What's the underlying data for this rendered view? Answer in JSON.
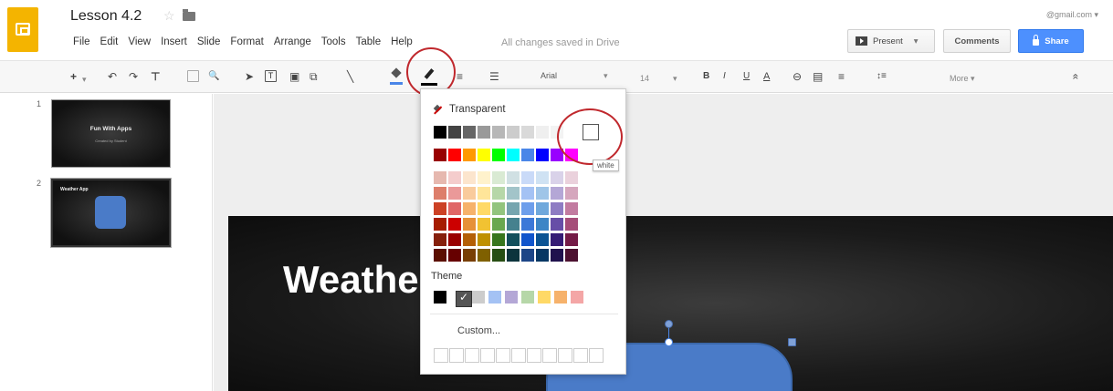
{
  "header": {
    "doc_title": "Lesson 4.2",
    "star_glyph": "☆",
    "account": "@gmail.com ▾",
    "save_status": "All changes saved in Drive",
    "menu": [
      "File",
      "Edit",
      "View",
      "Insert",
      "Slide",
      "Format",
      "Arrange",
      "Tools",
      "Table",
      "Help"
    ],
    "present_label": "Present",
    "present_caret": "▾",
    "comments_label": "Comments",
    "share_label": "Share"
  },
  "toolbar": {
    "add_glyph": "+",
    "add_caret": "▾",
    "undo_glyph": "↶",
    "redo_glyph": "↷",
    "paint_format_glyph": "⊤",
    "zoom_glyph": "🔍",
    "select_glyph": "➤",
    "textbox_glyph": "T",
    "image_glyph": "▣",
    "shape_glyph": "⧉",
    "line_glyph": "╲",
    "dash_glyph": "≡",
    "weight_glyph": "☰",
    "font": "Arial",
    "font_caret": "▾",
    "font_size": "14",
    "size_caret": "▾",
    "bold": "B",
    "italic": "I",
    "underline": "U",
    "text_color": "A",
    "link_glyph": "⊖",
    "comment_glyph": "▤",
    "align_glyph": "≡",
    "spacing_glyph": "↕≡",
    "more_label": "More ▾",
    "collapse_glyph": "«"
  },
  "filmstrip": {
    "slides": [
      {
        "number": "1",
        "title": "Fun With Apps",
        "subtitle": "Created by Student"
      },
      {
        "number": "2",
        "title": "Weather App"
      }
    ]
  },
  "canvas": {
    "slide_title": "Weathe",
    "shape_color": "#4a7bc8"
  },
  "color_menu": {
    "transparent_label": "Transparent",
    "tooltip": "white",
    "theme_label": "Theme",
    "theme_check": "✓",
    "custom_label": "Custom...",
    "grays": [
      "#000000",
      "#434343",
      "#666666",
      "#999999",
      "#b7b7b7",
      "#cccccc",
      "#d9d9d9",
      "#efefef",
      "#f3f3f3",
      "#ffffff"
    ],
    "brights": [
      "#980000",
      "#ff0000",
      "#ff9900",
      "#ffff00",
      "#00ff00",
      "#00ffff",
      "#4a86e8",
      "#0000ff",
      "#9900ff",
      "#ff00ff"
    ],
    "tints": [
      [
        "#e6b8af",
        "#f4cccc",
        "#fce5cd",
        "#fff2cc",
        "#d9ead3",
        "#d0e0e3",
        "#c9daf8",
        "#cfe2f3",
        "#d9d2e9",
        "#ead1dc"
      ],
      [
        "#dd7e6b",
        "#ea9999",
        "#f9cb9c",
        "#ffe599",
        "#b6d7a8",
        "#a2c4c9",
        "#a4c2f4",
        "#9fc5e8",
        "#b4a7d6",
        "#d5a6bd"
      ],
      [
        "#cc4125",
        "#e06666",
        "#f6b26b",
        "#ffd966",
        "#93c47d",
        "#76a5af",
        "#6d9eeb",
        "#6fa8dc",
        "#8e7cc3",
        "#c27ba0"
      ],
      [
        "#a61c00",
        "#cc0000",
        "#e69138",
        "#f1c232",
        "#6aa84f",
        "#45818e",
        "#3c78d8",
        "#3d85c6",
        "#674ea7",
        "#a64d79"
      ],
      [
        "#85200c",
        "#990000",
        "#b45f06",
        "#bf9000",
        "#38761d",
        "#134f5c",
        "#1155cc",
        "#0b5394",
        "#351c75",
        "#741b47"
      ],
      [
        "#5b0f00",
        "#660000",
        "#783f04",
        "#7f6000",
        "#274e13",
        "#0c343d",
        "#1c4587",
        "#073763",
        "#20124d",
        "#4c1130"
      ]
    ],
    "theme_colors": [
      "#000000",
      "#555555",
      "#cccccc",
      "#a4c2f4",
      "#b4a7d6",
      "#b6d7a8",
      "#ffd966",
      "#f6b26b",
      "#f4a6a6"
    ]
  }
}
